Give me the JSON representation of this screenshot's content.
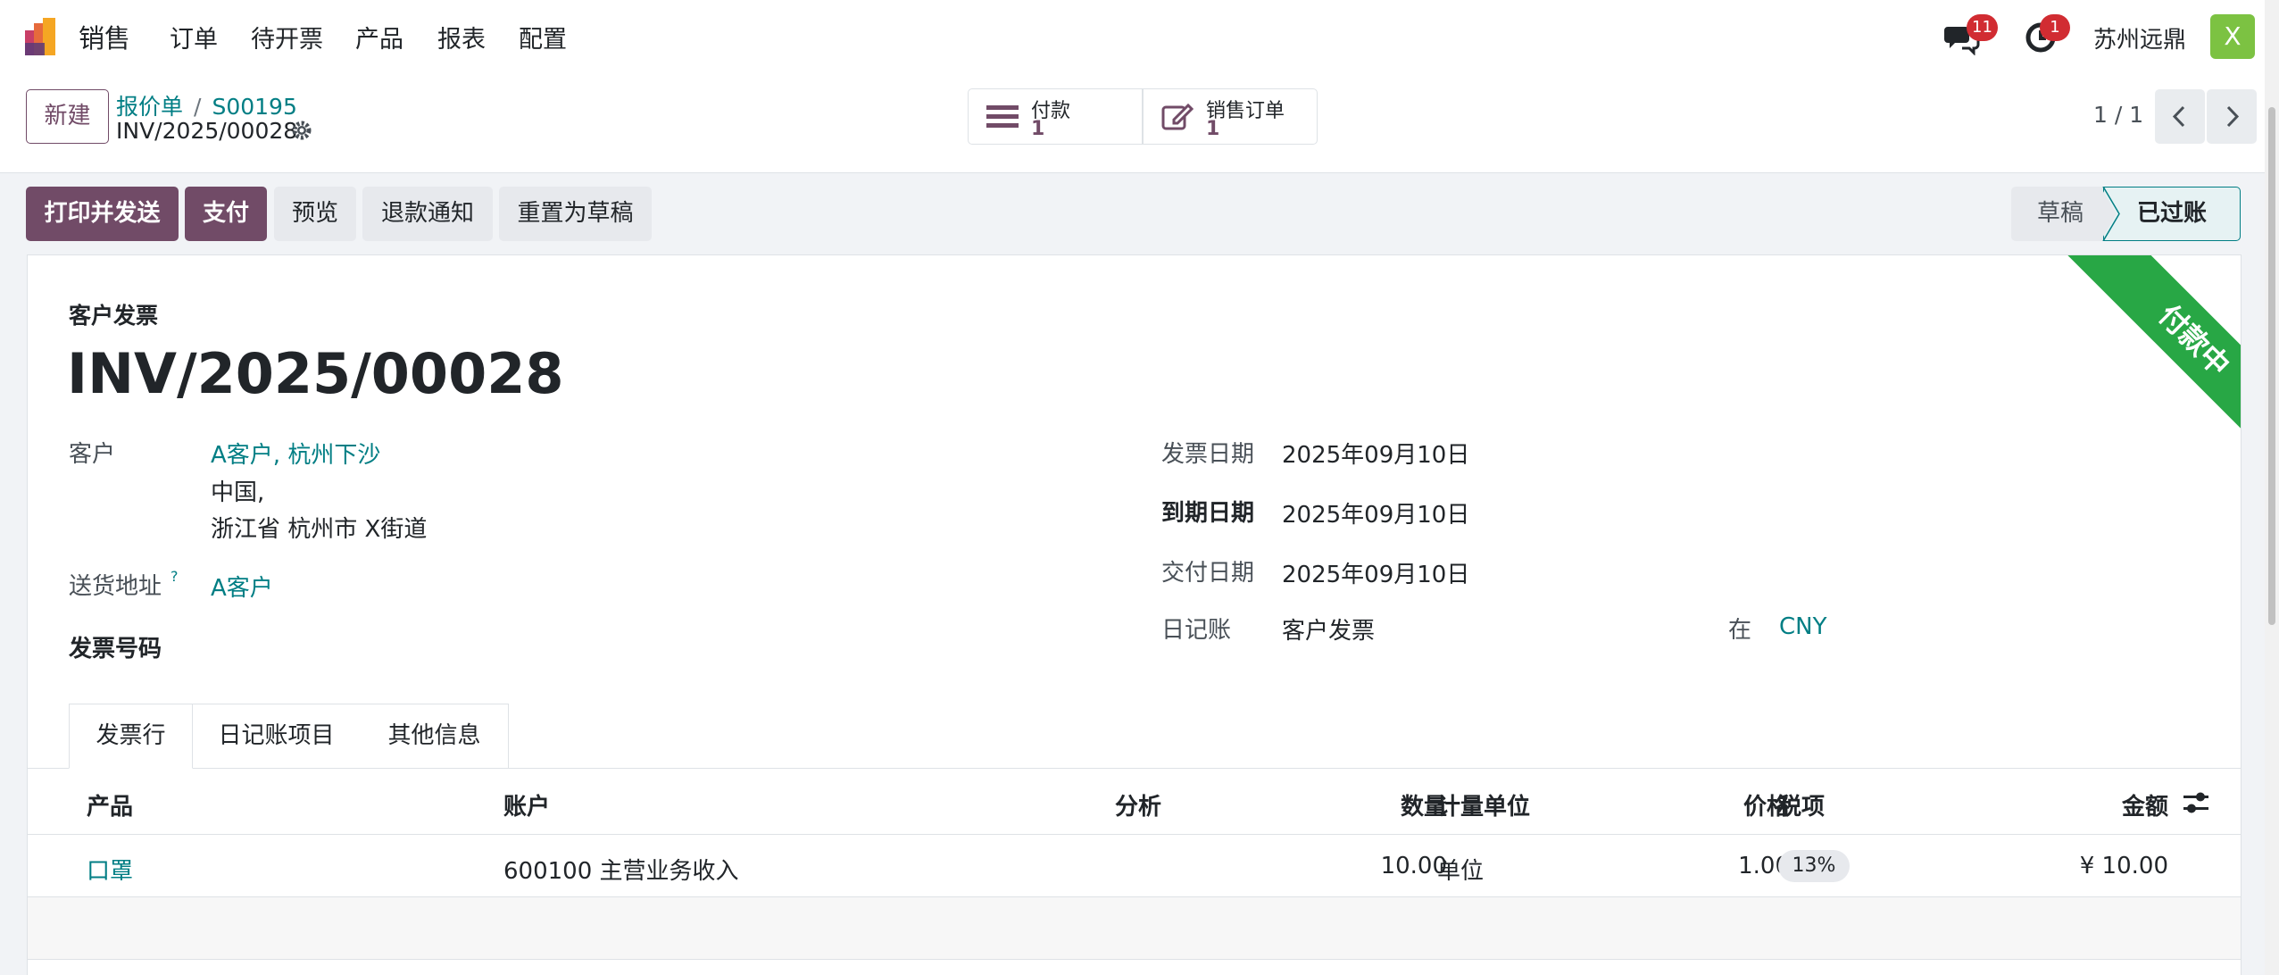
{
  "navbar": {
    "app_name": "销售",
    "menu": [
      "订单",
      "待开票",
      "产品",
      "报表",
      "配置"
    ],
    "messages_badge": "11",
    "activities_badge": "1",
    "company": "苏州远鼎",
    "avatar_letter": "X",
    "icons": {
      "brand": "odoo-sales-logo",
      "messages": "chat-bubbles-icon",
      "activities": "clock-icon"
    }
  },
  "control": {
    "new_label": "新建",
    "breadcrumb": [
      "报价单",
      "S00195"
    ],
    "record_name": "INV/2025/00028",
    "smart_buttons": [
      {
        "label": "付款",
        "value": "1",
        "icon": "list-icon"
      },
      {
        "label": "销售订单",
        "value": "1",
        "icon": "edit-icon"
      }
    ],
    "pager": "1 / 1"
  },
  "actions": [
    "打印并发送",
    "支付",
    "预览",
    "退款通知",
    "重置为草稿"
  ],
  "status": {
    "draft": "草稿",
    "posted": "已过账"
  },
  "sheet": {
    "ribbon": "付款中",
    "doc_type": "客户发票",
    "doc_number": "INV/2025/00028",
    "customer_label": "客户",
    "customer_name": "A客户, 杭州下沙",
    "customer_addr1": "中国,",
    "customer_addr2": "浙江省 杭州市 X街道",
    "shipping_label": "送货地址",
    "shipping_help": "?",
    "shipping_value": "A客户",
    "ref_label": "发票号码",
    "invoice_date_label": "发票日期",
    "invoice_date": "2025年09月10日",
    "due_date_label": "到期日期",
    "due_date": "2025年09月10日",
    "delivery_date_label": "交付日期",
    "delivery_date": "2025年09月10日",
    "journal_label": "日记账",
    "journal": "客户发票",
    "in_label": "在",
    "currency": "CNY"
  },
  "tabs": [
    "发票行",
    "日记账项目",
    "其他信息"
  ],
  "table": {
    "headers": [
      "产品",
      "账户",
      "分析",
      "数量",
      "计量单位",
      "价格",
      "税项",
      "金额"
    ],
    "rows": [
      {
        "product": "口罩",
        "account": "600100 主营业务收入",
        "analytic": "",
        "qty": "10.00",
        "uom": "单位",
        "price": "1.00",
        "tax": "13%",
        "amount": "¥ 10.00"
      }
    ]
  },
  "colors": {
    "primary": "#714b67",
    "link": "#017e84",
    "ribbon": "#28a745",
    "badge": "#d12c32"
  }
}
